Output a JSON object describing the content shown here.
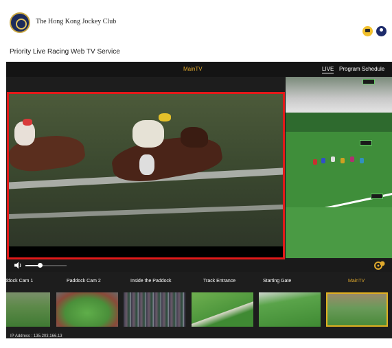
{
  "header": {
    "brand_name": "The Hong Kong Jockey Club",
    "brand_sub": "",
    "service_title": "Priority Live Racing Web TV Service"
  },
  "player": {
    "channel_title": "MainTV",
    "tab_live": "LIVE",
    "tab_schedule": "Program Schedule",
    "volume_level": 0.35
  },
  "cameras": [
    {
      "label": "ddock Cam 1"
    },
    {
      "label": "Paddock Cam 2"
    },
    {
      "label": "Inside the Paddock"
    },
    {
      "label": "Track Entrance"
    },
    {
      "label": "Starting Gate"
    },
    {
      "label": "MainTV",
      "active": true
    }
  ],
  "footer": {
    "ip_address": "IP Address : 135.203.166.13"
  },
  "colors": {
    "accent": "#e0a92d",
    "highlight_border": "#e21919",
    "dark_bg": "#1d1d1d"
  }
}
